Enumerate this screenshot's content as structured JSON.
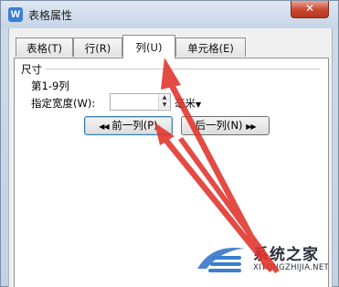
{
  "window": {
    "app_icon": "W",
    "title": "表格属性",
    "close_label": "✕"
  },
  "tabs": [
    {
      "label": "表格(T)",
      "active": false
    },
    {
      "label": "行(R)",
      "active": false
    },
    {
      "label": "列(U)",
      "active": true
    },
    {
      "label": "单元格(E)",
      "active": false
    }
  ],
  "size_group": {
    "title": "尺寸",
    "range_label": "第1-9列",
    "width_label": "指定宽度(W):",
    "width_value": "",
    "unit_label": "毫米"
  },
  "buttons": {
    "prev": "前一列(P)",
    "next": "后一列(N)"
  },
  "watermark": {
    "title": "系统之家",
    "url": "XITONGZHIJIA.NET"
  },
  "colors": {
    "arrow": "#e0332b",
    "accent": "#3a7fd6"
  },
  "icons": {
    "app": "wps-writer-icon",
    "close": "close-icon",
    "spin_up": "triangle-up-icon",
    "spin_down": "triangle-down-icon",
    "prev_arrows": "double-left-arrow-icon",
    "next_arrows": "double-right-arrow-icon",
    "dropdown": "caret-down-icon"
  }
}
